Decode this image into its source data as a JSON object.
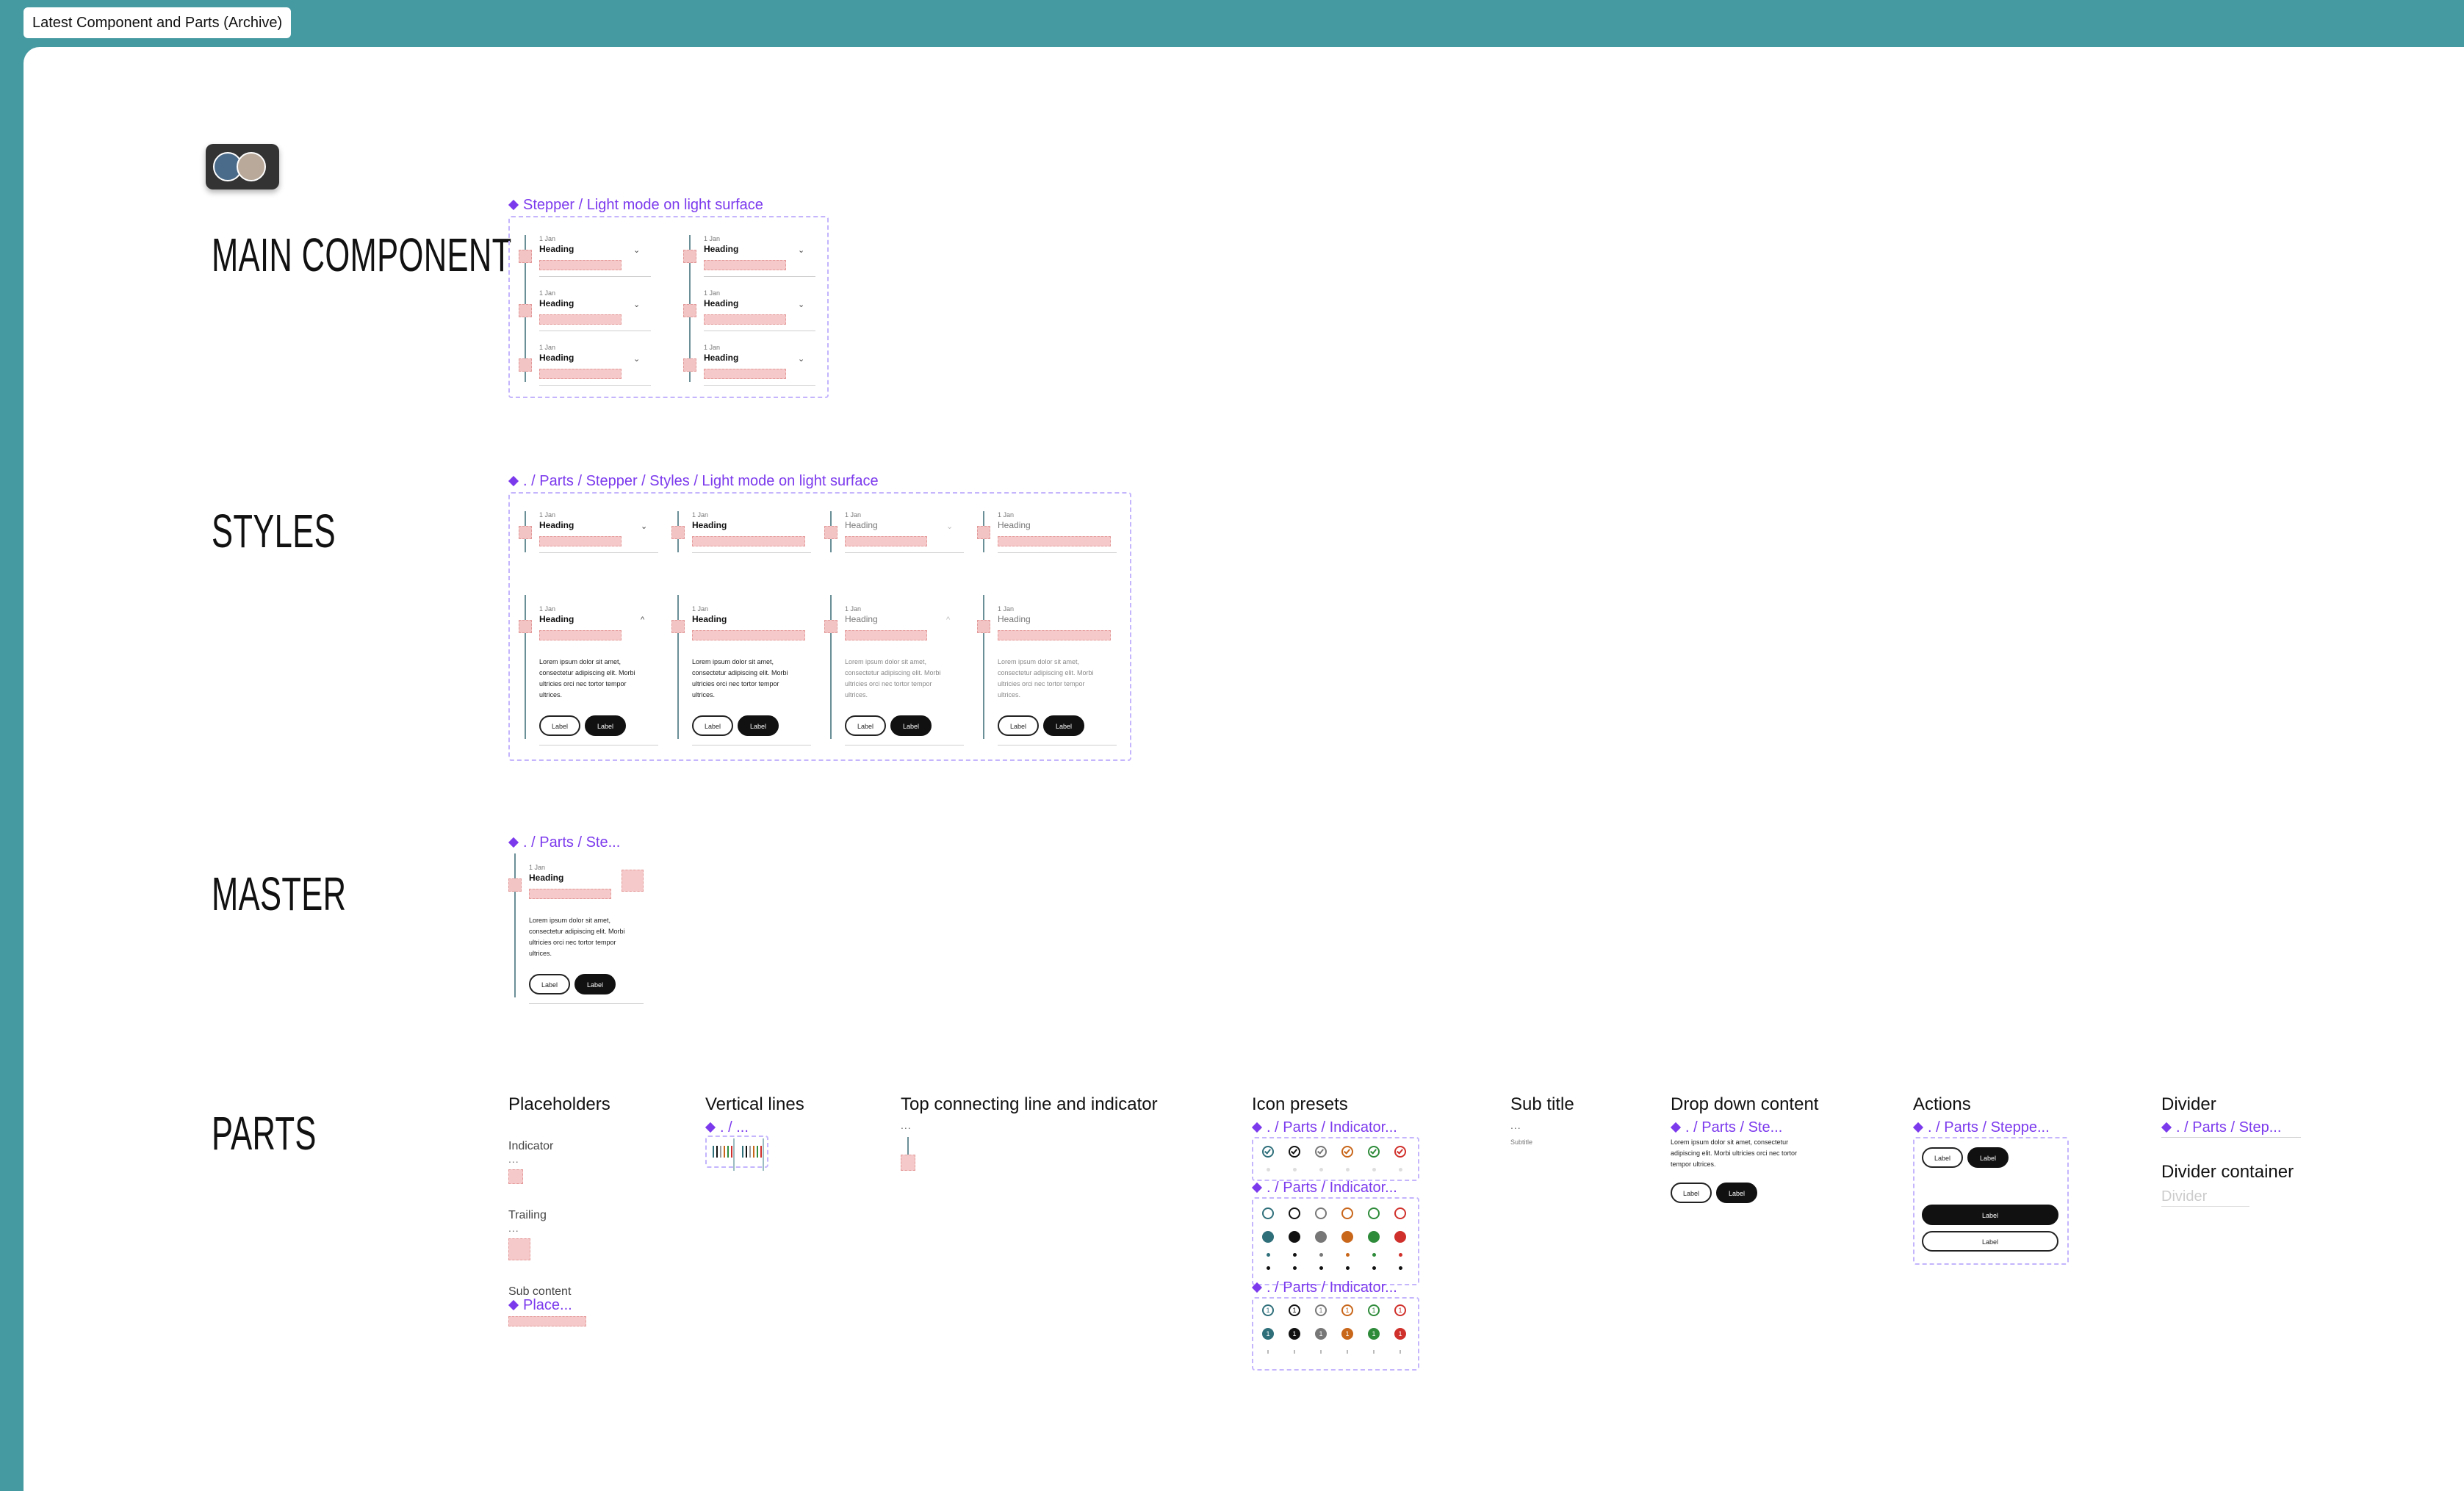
{
  "page_tab": "Latest Component and Parts (Archive)",
  "sections": {
    "main": "MAIN COMPONENT",
    "styles": "STYLES",
    "master": "MASTER",
    "parts": "PARTS"
  },
  "component_labels": {
    "main": "Stepper / Light mode on light surface",
    "styles": ". / Parts / Stepper / Styles / Light mode on light surface",
    "master": ". / Parts / Ste..."
  },
  "step": {
    "date": "1 Jan",
    "heading": "Heading",
    "chevron_down": "⌄",
    "chevron_up": "^",
    "body": "Lorem ipsum dolor sit amet, consectetur adipiscing elit. Morbi ultricies orci nec tortor tempor ultrices.",
    "btn_outline": "Label",
    "btn_filled": "Label"
  },
  "parts": {
    "placeholders": {
      "title": "Placeholders",
      "indicator": "Indicator",
      "trailing": "Trailing",
      "sub_content": "Sub content",
      "sub_content_comp": "Place...",
      "dots": "..."
    },
    "vertical_lines": {
      "title": "Vertical lines",
      "comp": ". / ..."
    },
    "top_line": {
      "title": "Top connecting line and indicator",
      "dots": "..."
    },
    "icon_presets": {
      "title": "Icon presets",
      "comp": ". / Parts / Indicator...",
      "comp2": ". / Parts / Indicator...",
      "comp3": ". / Parts / Indicator...",
      "numbers": [
        "1",
        "1",
        "1",
        "1",
        "1",
        "1"
      ]
    },
    "sub_title": {
      "title": "Sub title",
      "dots": "...",
      "text": "Subtitle"
    },
    "drop_down": {
      "title": "Drop down content",
      "comp": ". / Parts / Ste...",
      "body": "Lorem ipsum dolor sit amet, consectetur adipiscing elit. Morbi ultricies orci nec tortor tempor ultrices.",
      "btn_outline": "Label",
      "btn_filled": "Label"
    },
    "actions": {
      "title": "Actions",
      "comp": ". / Parts / Steppe...",
      "btn_outline": "Label",
      "btn_filled": "Label",
      "btn_full_filled": "Label",
      "btn_full_outline": "Label"
    },
    "divider": {
      "title": "Divider",
      "comp": ". / Parts / Step...",
      "container_title": "Divider container",
      "placeholder": "Divider"
    }
  },
  "colors": {
    "background": "#4599a1",
    "component_purple": "#7c3aed",
    "placeholder_pink": "#f5c9c9",
    "indicator_teal": "#2f6f7a",
    "indicator_black": "#111111",
    "indicator_grey": "#777777",
    "indicator_orange": "#c8661a",
    "indicator_green": "#2e8b3a",
    "indicator_red": "#d0302b"
  }
}
